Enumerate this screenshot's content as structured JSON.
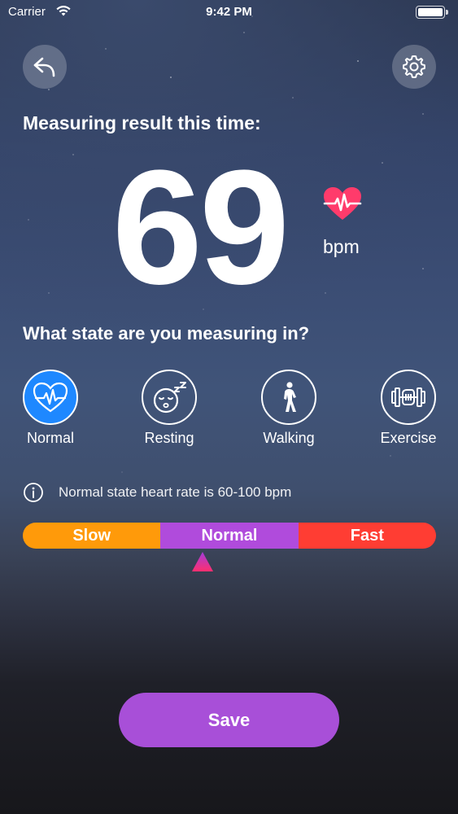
{
  "status_bar": {
    "carrier": "Carrier",
    "time": "9:42 PM"
  },
  "header": {
    "back_icon": "reply-arrow-icon",
    "settings_icon": "gear-icon"
  },
  "result": {
    "title": "Measuring result this time:",
    "value": "69",
    "unit": "bpm",
    "heart_icon": "heart-pulse-icon"
  },
  "states": {
    "title": "What state are you measuring in?",
    "selected": "Normal",
    "items": [
      {
        "label": "Normal",
        "icon": "heart-pulse-icon"
      },
      {
        "label": "Resting",
        "icon": "sleeping-face-icon"
      },
      {
        "label": "Walking",
        "icon": "walking-person-icon"
      },
      {
        "label": "Exercise",
        "icon": "dumbbell-icon"
      }
    ]
  },
  "info": {
    "icon": "info-icon",
    "text": "Normal state heart rate is 60-100 bpm"
  },
  "range": {
    "segments": [
      "Slow",
      "Normal",
      "Fast"
    ],
    "current": "Normal",
    "colors": {
      "slow": "#ff9a0a",
      "normal": "#b04bdc",
      "fast": "#ff3d33"
    }
  },
  "actions": {
    "save_label": "Save"
  },
  "colors": {
    "accent": "#a84fd8",
    "selected_state": "#1e88ff",
    "heart": "#ff3b6b"
  }
}
